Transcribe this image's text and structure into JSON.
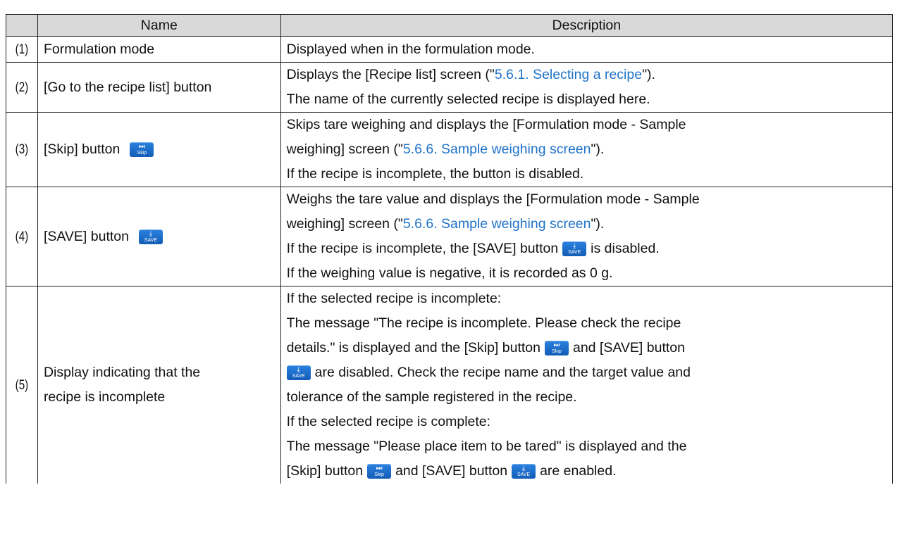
{
  "header": {
    "col_num": "",
    "col_name": "Name",
    "col_desc": "Description"
  },
  "rows": {
    "r1": {
      "num": "(1)",
      "name": "Formulation mode",
      "d1": "Displayed when in the formulation mode."
    },
    "r2": {
      "num": "(2)",
      "name": "[Go to the recipe list] button",
      "d1a": "Displays the [Recipe list] screen (\"",
      "d1link": "5.6.1. Selecting a recipe",
      "d1b": "\").",
      "d2": "The name of the currently selected recipe is displayed here."
    },
    "r3": {
      "num": "(3)",
      "name": "[Skip] button",
      "d1": "Skips tare weighing and displays the [Formulation mode - Sample",
      "d2a": "weighing] screen (\"",
      "d2link": "5.6.6. Sample weighing screen",
      "d2b": "\").",
      "d3": "If the recipe is incomplete, the button is disabled."
    },
    "r4": {
      "num": "(4)",
      "name": "[SAVE] button",
      "d1": "Weighs the tare value and displays the [Formulation mode - Sample",
      "d2a": "weighing] screen (\"",
      "d2link": "5.6.6. Sample weighing screen",
      "d2b": "\").",
      "d3a": "If the recipe is incomplete, the [SAVE] button",
      "d3b": "is disabled.",
      "d4": "If the weighing value is negative, it is recorded as 0 g."
    },
    "r5": {
      "num": "(5)",
      "name1": "Display indicating that the",
      "name2": "recipe is incomplete",
      "d1": "If the selected recipe is incomplete:",
      "d2": "The message \"The recipe is incomplete. Please check the recipe",
      "d3a": "details.\" is displayed and the [Skip] button",
      "d3b": "and [SAVE] button",
      "d4": "are disabled. Check the recipe name and the target value and",
      "d5": "tolerance of the sample registered in the recipe.",
      "d6": "If the selected recipe is complete:",
      "d7": "The message \"Please place item to be tared\" is displayed and the",
      "d8a": "[Skip] button",
      "d8b": "and [SAVE] button",
      "d8c": "are enabled."
    }
  },
  "icons": {
    "skip": {
      "name": "skip-forward-icon",
      "glyph": "⏭",
      "text": "Skip"
    },
    "save": {
      "name": "save-download-icon",
      "glyph": "⤓",
      "text": "SAVE"
    }
  },
  "colors": {
    "link": "#1f73c8",
    "header_bg": "#d9d9d9",
    "icon_blue": "#1a6fd0"
  }
}
